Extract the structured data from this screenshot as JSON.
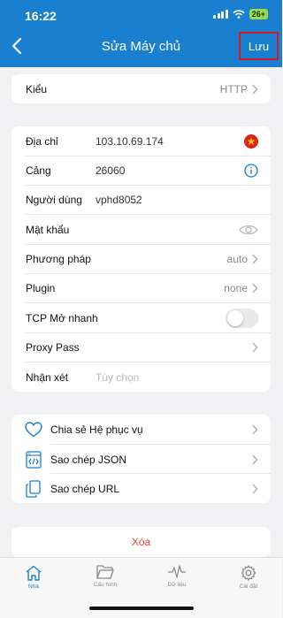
{
  "status_bar": {
    "time": "16:22",
    "battery": "26+"
  },
  "nav": {
    "title": "Sửa Máy chủ",
    "save_label": "Lưu"
  },
  "type_row": {
    "label": "Kiểu",
    "value": "HTTP"
  },
  "form": {
    "address": {
      "label": "Địa chỉ",
      "value": "103.10.69.174"
    },
    "port": {
      "label": "Cảng",
      "value": "26060"
    },
    "user": {
      "label": "Người dùng",
      "value": "vphd8052"
    },
    "password": {
      "label": "Mật khẩu",
      "value": ""
    },
    "method": {
      "label": "Phương pháp",
      "value": "auto"
    },
    "plugin": {
      "label": "Plugin",
      "value": "none"
    },
    "tcp_fast": {
      "label": "TCP Mở nhanh",
      "enabled": false
    },
    "proxy_pass": {
      "label": "Proxy Pass"
    },
    "note": {
      "label": "Nhận xét",
      "placeholder": "Tùy chọn"
    }
  },
  "actions": [
    {
      "label": "Chia sẻ Hệ phục vụ",
      "icon": "heart-icon"
    },
    {
      "label": "Sao chép JSON",
      "icon": "code-file-icon"
    },
    {
      "label": "Sao chép URL",
      "icon": "copy-icon"
    }
  ],
  "delete_label": "Xóa",
  "tabs": [
    {
      "label": "Nhà",
      "icon": "home-icon",
      "active": true
    },
    {
      "label": "Cấu hình",
      "icon": "folder-icon",
      "active": false
    },
    {
      "label": "Dữ liệu",
      "icon": "activity-icon",
      "active": false
    },
    {
      "label": "Cài đặt",
      "icon": "gear-icon",
      "active": false
    }
  ],
  "colors": {
    "accent": "#1a7fcf",
    "danger": "#e2483d",
    "highlight_border": "#d01a2a"
  }
}
